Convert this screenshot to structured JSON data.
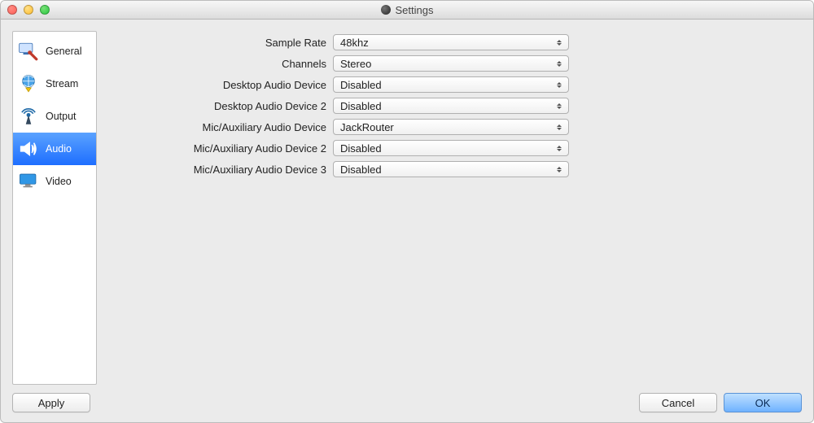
{
  "window": {
    "title": "Settings"
  },
  "sidebar": {
    "items": [
      {
        "label": "General"
      },
      {
        "label": "Stream"
      },
      {
        "label": "Output"
      },
      {
        "label": "Audio",
        "selected": true
      },
      {
        "label": "Video"
      }
    ]
  },
  "audio_settings": {
    "rows": [
      {
        "label": "Sample Rate",
        "value": "48khz"
      },
      {
        "label": "Channels",
        "value": "Stereo"
      },
      {
        "label": "Desktop Audio Device",
        "value": "Disabled"
      },
      {
        "label": "Desktop Audio Device 2",
        "value": "Disabled"
      },
      {
        "label": "Mic/Auxiliary Audio Device",
        "value": "JackRouter"
      },
      {
        "label": "Mic/Auxiliary Audio Device 2",
        "value": "Disabled"
      },
      {
        "label": "Mic/Auxiliary Audio Device 3",
        "value": "Disabled"
      }
    ]
  },
  "buttons": {
    "apply": "Apply",
    "cancel": "Cancel",
    "ok": "OK"
  }
}
